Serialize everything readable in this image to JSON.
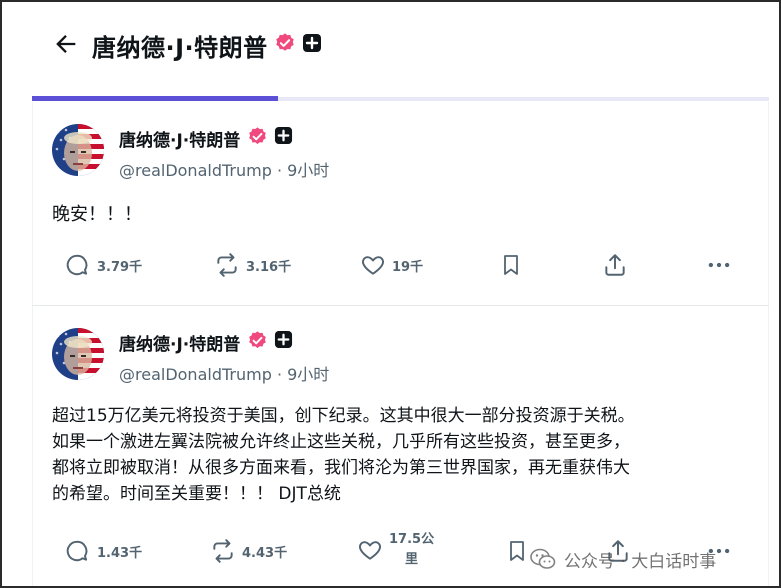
{
  "header": {
    "back_label": "",
    "name": "唐纳德·J·特朗普",
    "tabs": [
      "",
      "",
      ""
    ]
  },
  "posts": [
    {
      "name": "唐纳德·J·特朗普",
      "handle": "@realDonaldTrump · 9小时",
      "text": "晚安！！！",
      "actions": {
        "reply": "3.79千",
        "repost": "3.16千",
        "like": "19千",
        "bookmark": "",
        "share": "",
        "more": ""
      }
    },
    {
      "name": "唐纳德·J·特朗普",
      "handle": "@realDonaldTrump · 9小时",
      "text_lines": [
        "超过15万亿美元将投资于美国，创下纪录。这其中很大一部分投资源于关税。",
        "如果一个激进左翼法院被允许终止这些关税，几乎所有这些投资，甚至更多，",
        "都将立即被取消！从很多方面来看，我们将沦为第三世界国家，再无重获伟大",
        "的希望。时间至关重要！！！ DJT总统"
      ],
      "actions": {
        "reply": "1.43千",
        "repost": "4.43千",
        "like_line1": "17.5公",
        "like_line2": "里",
        "bookmark": "",
        "share": "",
        "more": ""
      }
    }
  ],
  "watermark": {
    "text": "公众号 · 大白话时事"
  },
  "colors": {
    "accent": "#5b50d6",
    "verified": "#f0497e",
    "muted": "#536471"
  }
}
